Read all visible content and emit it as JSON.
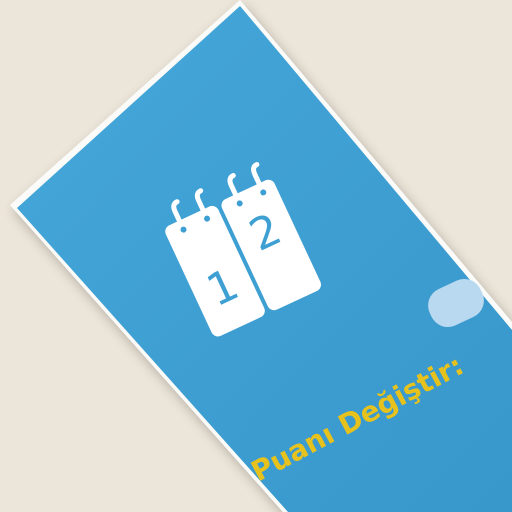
{
  "photo": {
    "background_color": "#ece5d9",
    "card_color": "#3e9fd3",
    "caption_color": "#e8c21c",
    "icon_color": "#ffffff",
    "caption": "Puanı Değiştir:",
    "icon": {
      "name": "flip-score-calendar-icon",
      "left_number": "1",
      "right_number": "2"
    },
    "button": "rounded-rectangle-button"
  }
}
